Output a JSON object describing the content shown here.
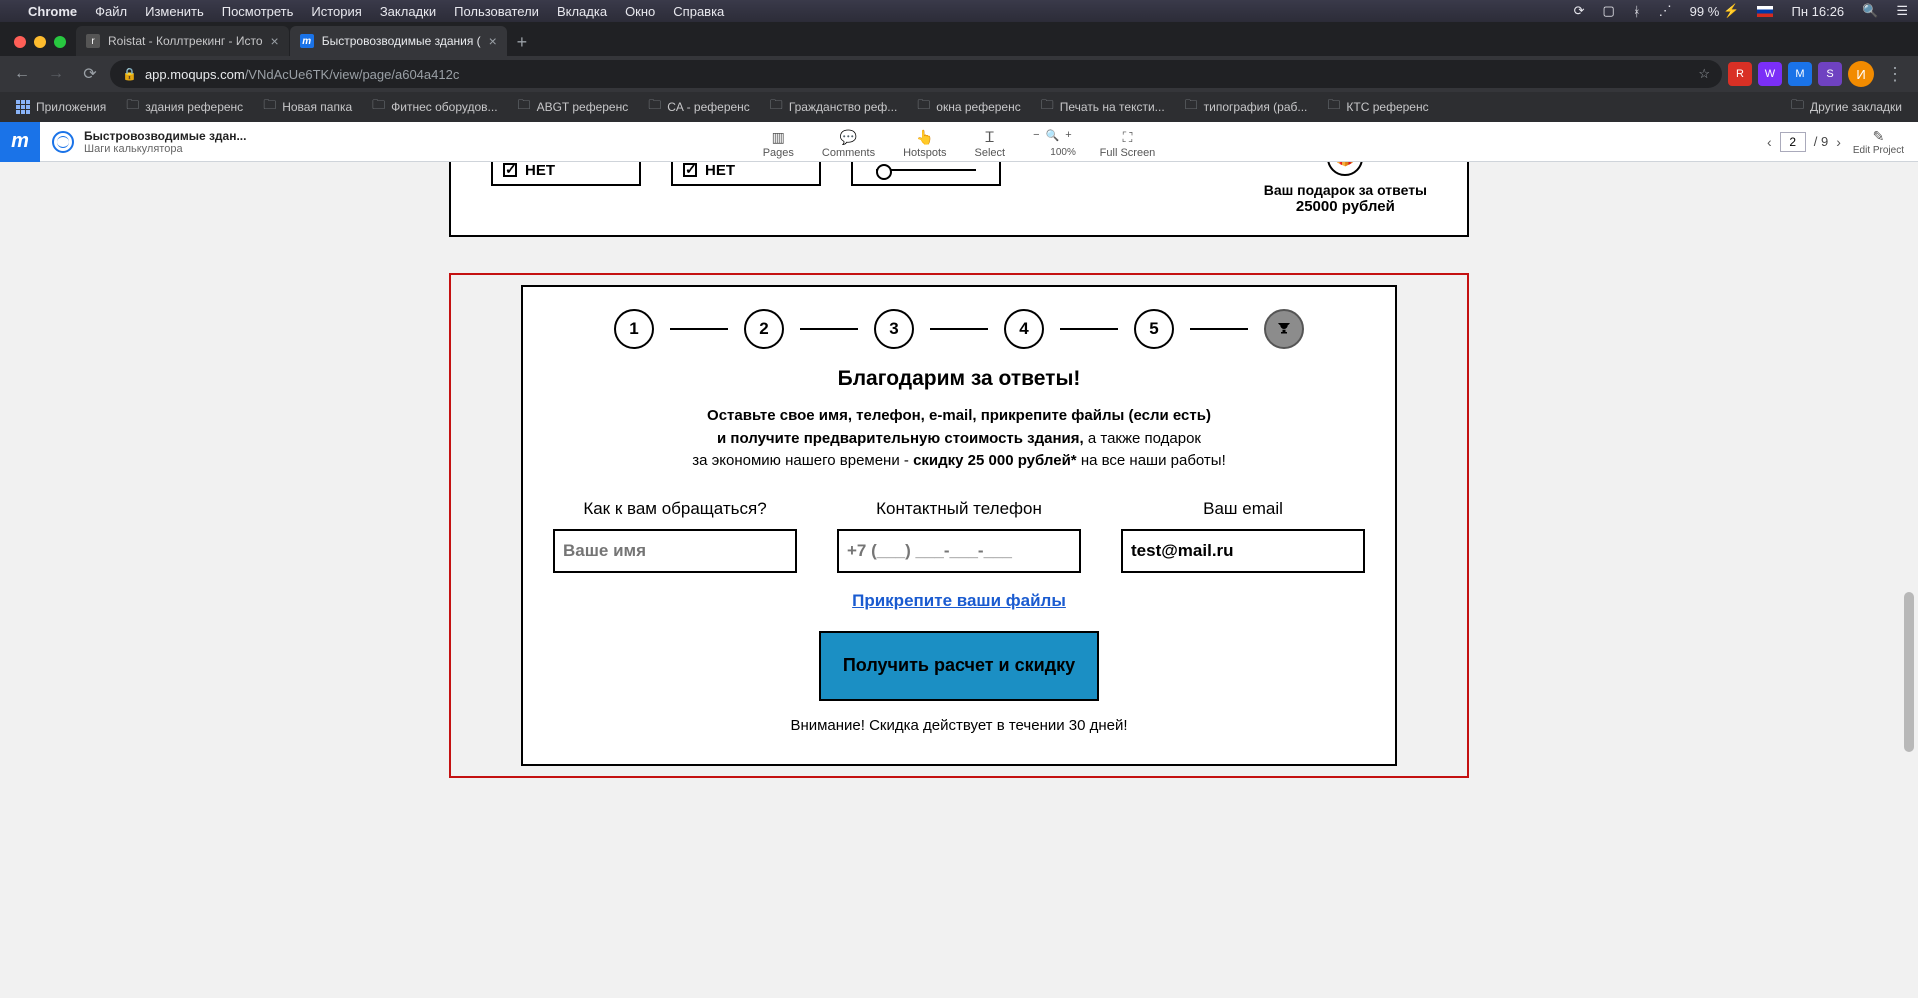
{
  "menubar": {
    "app": "Chrome",
    "items": [
      "Файл",
      "Изменить",
      "Посмотреть",
      "История",
      "Закладки",
      "Пользователи",
      "Вкладка",
      "Окно",
      "Справка"
    ],
    "battery": "99 %",
    "clock": "Пн 16:26"
  },
  "tabs": {
    "t1": {
      "title": "Roistat - Коллтрекинг - Исто"
    },
    "t2": {
      "title": "Быстровозводимые здания ("
    }
  },
  "addr": {
    "host": "app.moqups.com",
    "path": "/VNdAcUe6TK/view/page/a604a412c"
  },
  "bookmarks": {
    "apps": "Приложения",
    "b1": "здания референс",
    "b2": "Новая папка",
    "b3": "Фитнес оборудов...",
    "b4": "ABGT референс",
    "b5": "CA - референс",
    "b6": "Гражданство реф...",
    "b7": "окна референс",
    "b8": "Печать на тексти...",
    "b9": "типография (раб...",
    "b10": "КТС референс",
    "other": "Другие закладки"
  },
  "moq": {
    "project_title": "Быстровозводимые здан...",
    "project_sub": "Шаги калькулятора",
    "tools": {
      "pages": "Pages",
      "comments": "Comments",
      "hotspots": "Hotspots",
      "select": "Select",
      "zoom": "100%",
      "full": "Full Screen"
    },
    "page_current": "2",
    "page_total": "/ 9",
    "edit": "Edit Project"
  },
  "top_card": {
    "opt_label": "НЕТ",
    "gift_line1": "Ваш подарок за ответы",
    "gift_line2": "25000 рублей"
  },
  "form": {
    "steps": [
      "1",
      "2",
      "3",
      "4",
      "5"
    ],
    "thanks": "Благодарим за ответы!",
    "lead_b1": "Оставьте свое имя, телефон, e-mail, прикрепите файлы (если есть)",
    "lead_b2": "и получите предварительную стоимость здания,",
    "lead_p2": " а также подарок",
    "lead_p3a": "за экономию нашего времени - ",
    "lead_b3": "скидку 25 000 рублей*",
    "lead_p3b": " на все наши работы!",
    "name_label": "Как к вам обращаться?",
    "name_ph": "Ваше имя",
    "phone_label": "Контактный телефон",
    "phone_ph": "+7 (___) ___-___-___",
    "email_label": "Ваш email",
    "email_val": "test@mail.ru",
    "attach": "Прикрепите ваши файлы",
    "cta": "Получить расчет и скидку",
    "note": "Внимание! Скидка действует в течении 30 дней!"
  },
  "avatar_letter": "И"
}
